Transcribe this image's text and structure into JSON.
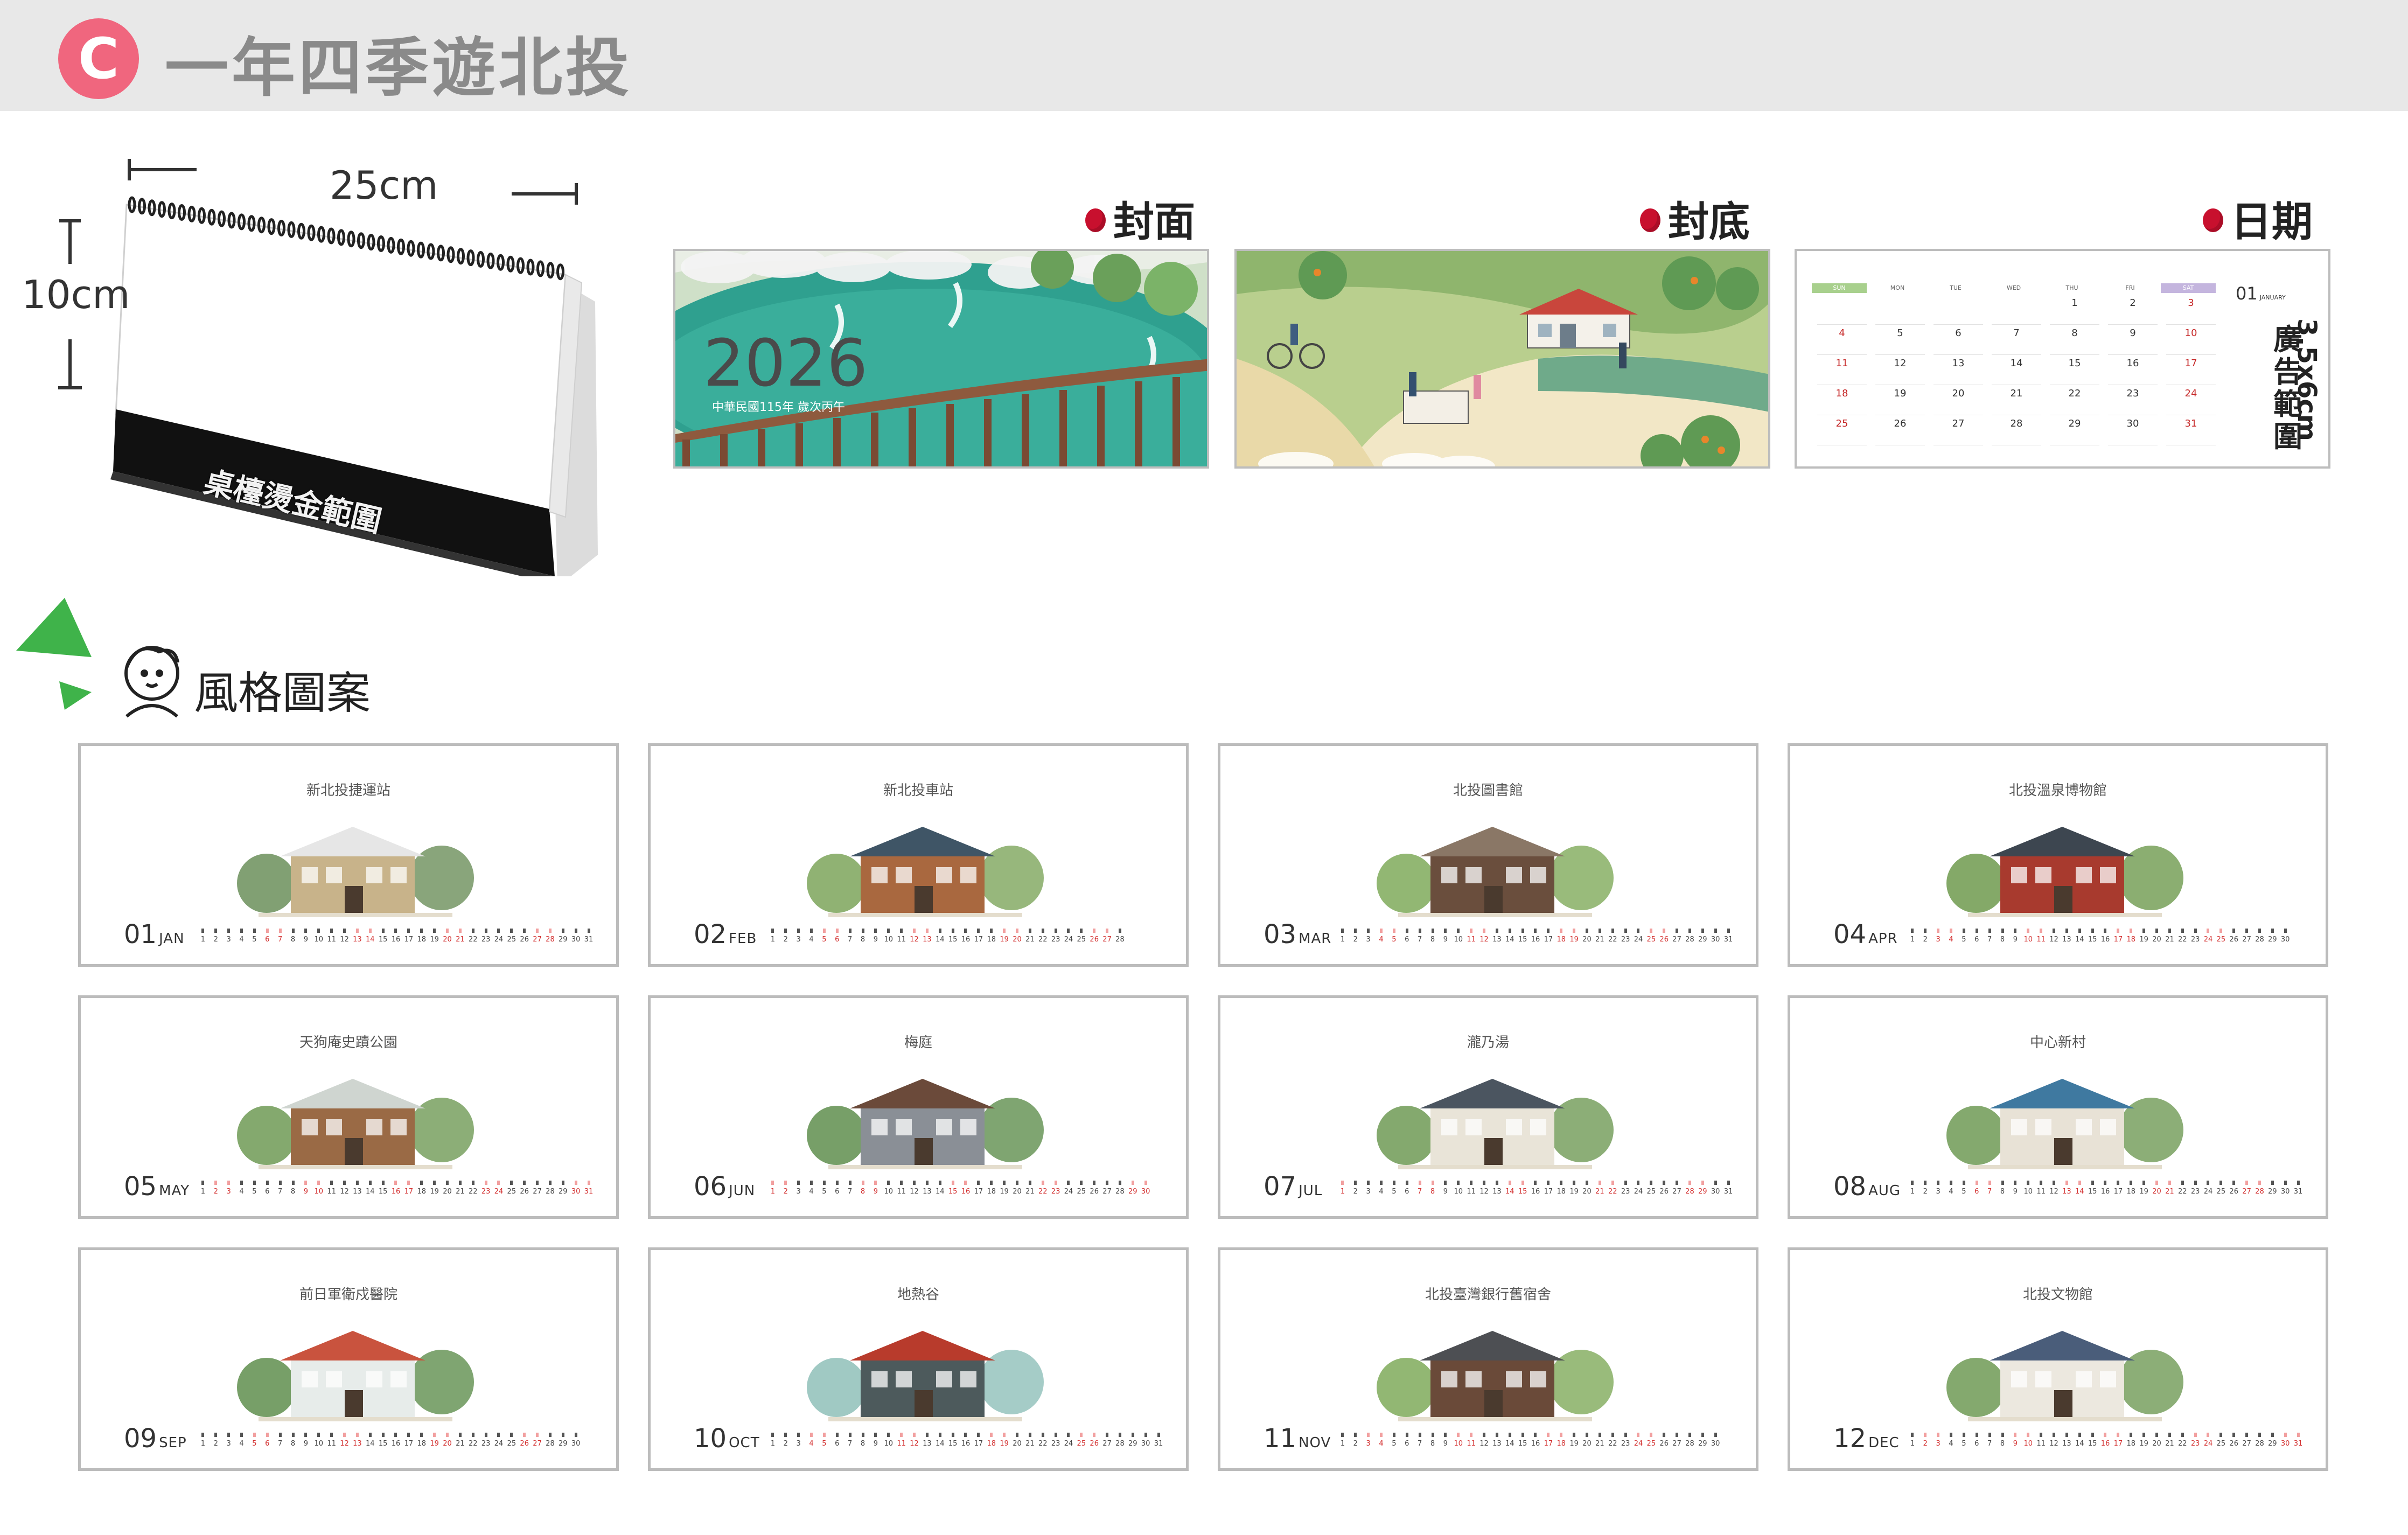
{
  "header": {
    "badge": "C",
    "title": "一年四季遊北投"
  },
  "product": {
    "width_label": "25cm",
    "height_label": "10cm",
    "base_text": "桌檯燙金範圍"
  },
  "previews": {
    "cover_label": "封面",
    "back_label": "封底",
    "date_label": "日期",
    "cover": {
      "year": "2026",
      "subtitle": "中華民國115年 歲次丙午"
    },
    "date_page": {
      "month_num": "01",
      "month_name": "JANUARY",
      "ad_text": "廣告範圍",
      "ad_size": "3.5x6cm",
      "weekdays": [
        "SUN",
        "MON",
        "TUE",
        "WED",
        "THU",
        "FRI",
        "SAT"
      ],
      "weeks": [
        [
          "",
          "",
          "",
          "",
          "1",
          "2",
          "3"
        ],
        [
          "4",
          "5",
          "6",
          "7",
          "8",
          "9",
          "10"
        ],
        [
          "11",
          "12",
          "13",
          "14",
          "15",
          "16",
          "17"
        ],
        [
          "18",
          "19",
          "20",
          "21",
          "22",
          "23",
          "24"
        ],
        [
          "25",
          "26",
          "27",
          "28",
          "29",
          "30",
          "31"
        ]
      ]
    }
  },
  "style_section": {
    "heading": "風格圖案"
  },
  "months": [
    {
      "num": "01",
      "abbr": "JAN",
      "place": "新北投捷運站"
    },
    {
      "num": "02",
      "abbr": "FEB",
      "place": "新北投車站"
    },
    {
      "num": "03",
      "abbr": "MAR",
      "place": "北投圖書館"
    },
    {
      "num": "04",
      "abbr": "APR",
      "place": "北投溫泉博物館"
    },
    {
      "num": "05",
      "abbr": "MAY",
      "place": "天狗庵史蹟公園"
    },
    {
      "num": "06",
      "abbr": "JUN",
      "place": "梅庭"
    },
    {
      "num": "07",
      "abbr": "JUL",
      "place": "瀧乃湯"
    },
    {
      "num": "08",
      "abbr": "AUG",
      "place": "中心新村"
    },
    {
      "num": "09",
      "abbr": "SEP",
      "place": "前日軍衛戍醫院"
    },
    {
      "num": "10",
      "abbr": "OCT",
      "place": "地熱谷"
    },
    {
      "num": "11",
      "abbr": "NOV",
      "place": "北投臺灣銀行舊宿舍"
    },
    {
      "num": "12",
      "abbr": "DEC",
      "place": "北投文物館"
    }
  ]
}
